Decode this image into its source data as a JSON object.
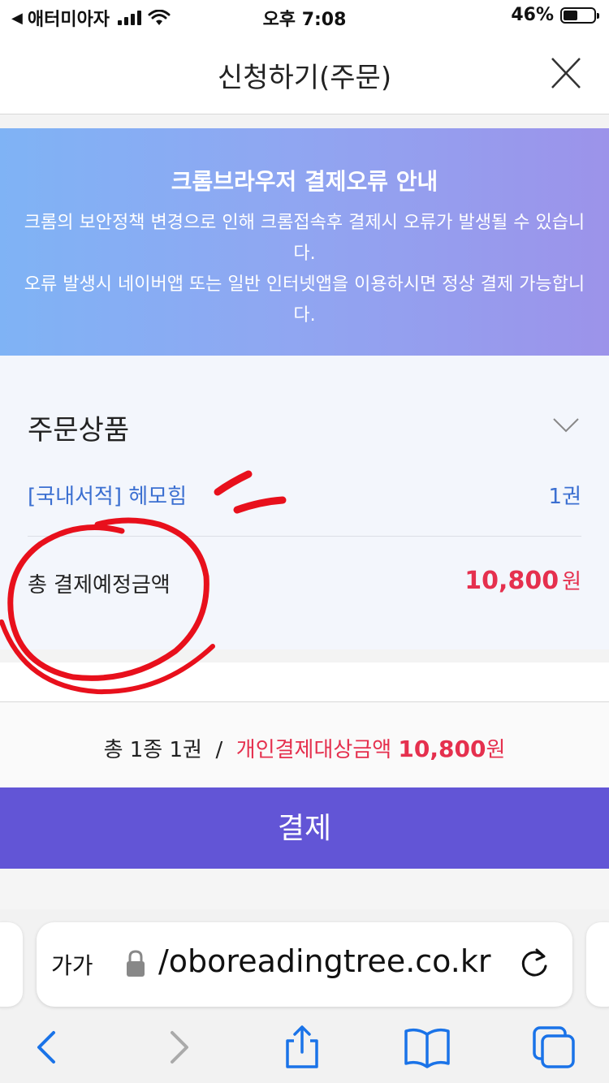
{
  "status_bar": {
    "carrier": "애터미아자",
    "time": "오후 7:08",
    "battery": "46%"
  },
  "header": {
    "title": "신청하기(주문)"
  },
  "banner": {
    "title": "크롬브라우저 결제오류 안내",
    "body": "크롬의 보안정책 변경으로 인해 크롬접속후 결제시 오류가 발생될 수 있습니\n다.\n오류 발생시 네이버앱 또는 일반 인터넷앱을 이용하시면 정상 결제 가능합니\n다."
  },
  "order": {
    "section_title": "주문상품",
    "item_name": "[국내서적] 헤모힘",
    "item_qty": "1권",
    "total_label": "총 결제예정금액",
    "total_amount": "10,800",
    "total_unit": "원"
  },
  "summary": {
    "count_text": "총 1종 1권",
    "slash": "/",
    "personal_label": "개인결제대상금액",
    "personal_amount": "10,800",
    "personal_unit": "원"
  },
  "pay_button": {
    "label": "결제"
  },
  "browser": {
    "aa_label": "가가",
    "url": "/oboreadingtree.co.kr"
  },
  "colors": {
    "accent_purple": "#6255d6",
    "price_red": "#e5304e",
    "link_blue": "#3b6fd1"
  }
}
